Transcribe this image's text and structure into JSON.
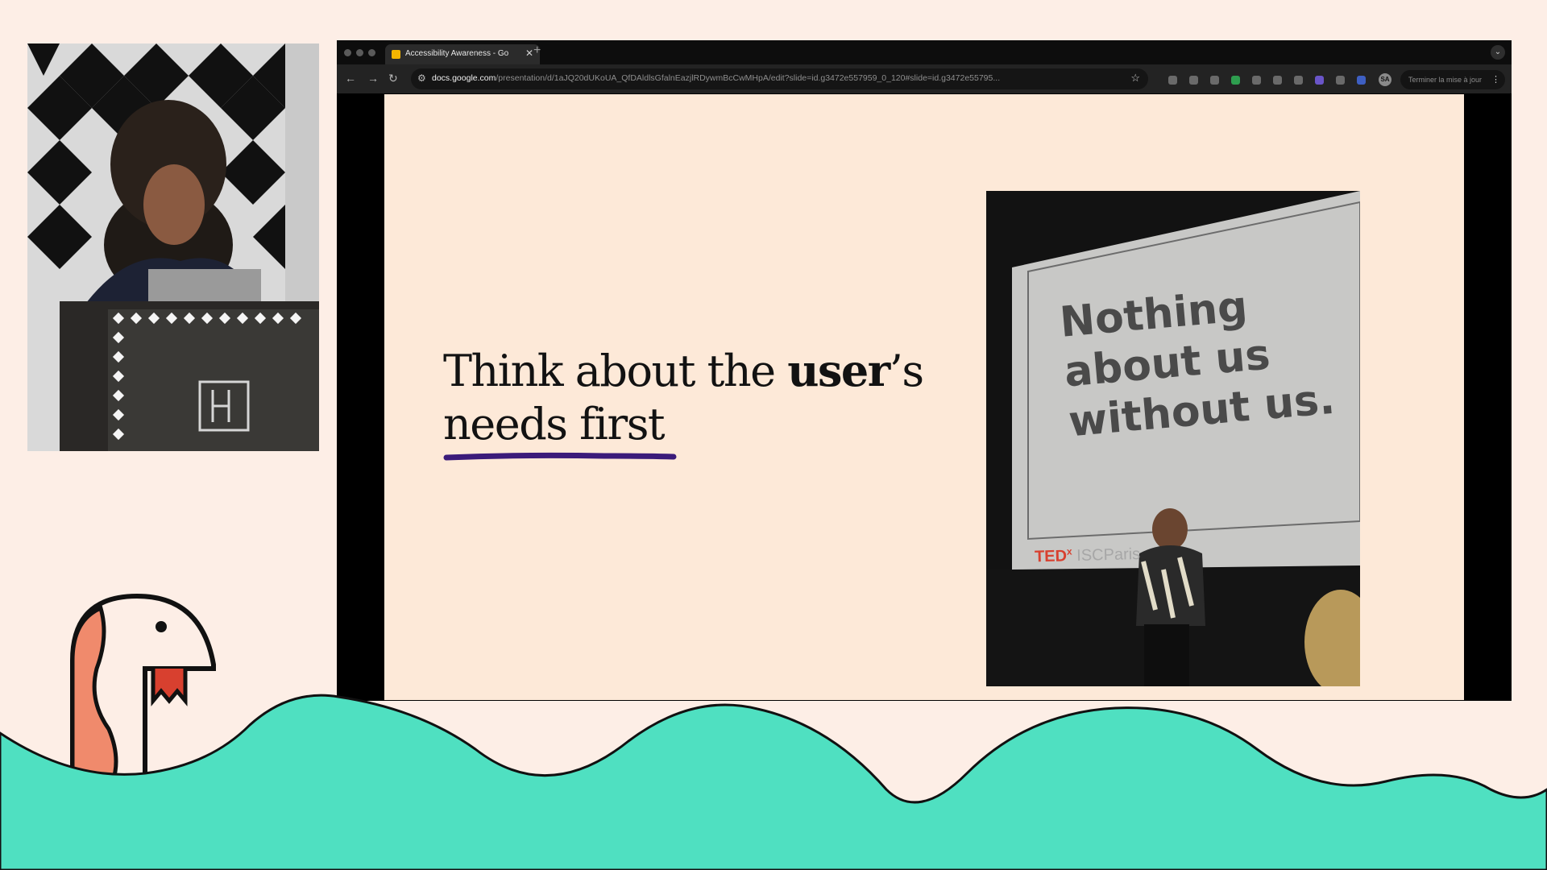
{
  "browser": {
    "tab": {
      "title": "Accessibility Awareness - Go"
    },
    "address_bar": {
      "host": "docs.google.com",
      "path": "/presentation/d/1aJQ20dUKoUA_QfDAldlsGfalnEazjlRDywmBcCwMHpA/edit?slide=id.g3472e557959_0_120#slide=id.g3472e55795..."
    },
    "update_button_label": "Terminer la mise à jour",
    "profile_initials": "SA"
  },
  "slide": {
    "heading_part1": "Think about the ",
    "heading_emphasis": "user",
    "heading_part2": "’s needs first",
    "photo": {
      "screen_text": "Nothing about us without us.",
      "logo_ted": "TED",
      "logo_x": "x",
      "logo_event": "ISCParis"
    }
  },
  "colors": {
    "page_background": "#fdeee6",
    "slide_background": "#fde9d8",
    "underline": "#3b1b7a",
    "wave": "#4fe0c1",
    "bird_accent": "#f08a6c"
  },
  "icons": [
    "back-arrow-icon",
    "forward-arrow-icon",
    "reload-icon",
    "site-info-icon",
    "star-icon",
    "menu-icon",
    "close-icon",
    "plus-icon",
    "chevron-down-icon"
  ]
}
